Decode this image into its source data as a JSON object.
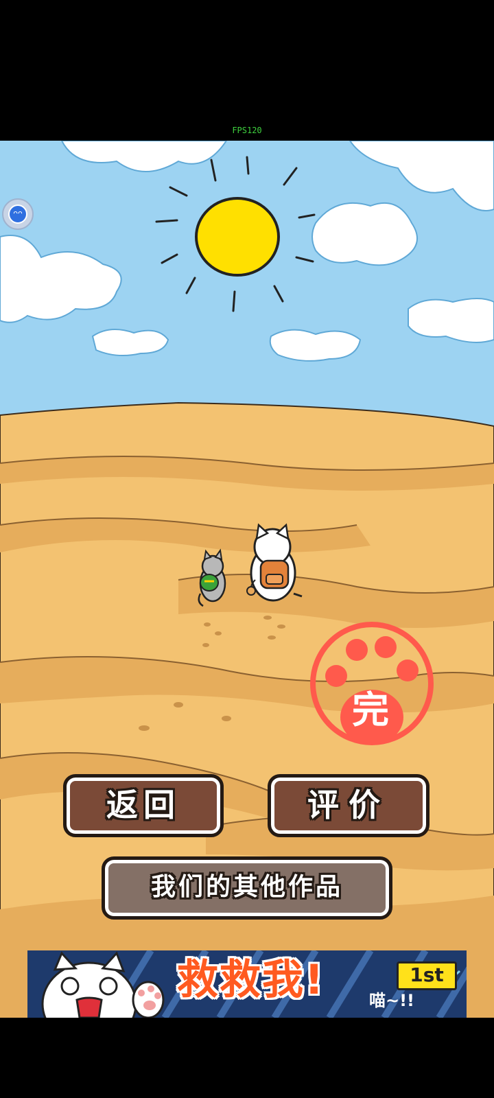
{
  "status": {
    "fps_label": "FPS120"
  },
  "floating_ball": {
    "label": "ᴖᴖ"
  },
  "ending": {
    "stamp_label": "完"
  },
  "buttons": {
    "back": "返回",
    "rate": "评价",
    "more_games": "我们的其他作品"
  },
  "banner_ad": {
    "title": "救救我!",
    "rank": "1st",
    "subtitle": "喵~!!"
  },
  "colors": {
    "sky": "#9dd3f2",
    "sand": "#f3c271",
    "sun": "#ffe000",
    "stamp": "#ff5a4c",
    "button_brown": "#7b4a37",
    "button_gray": "#847066"
  }
}
